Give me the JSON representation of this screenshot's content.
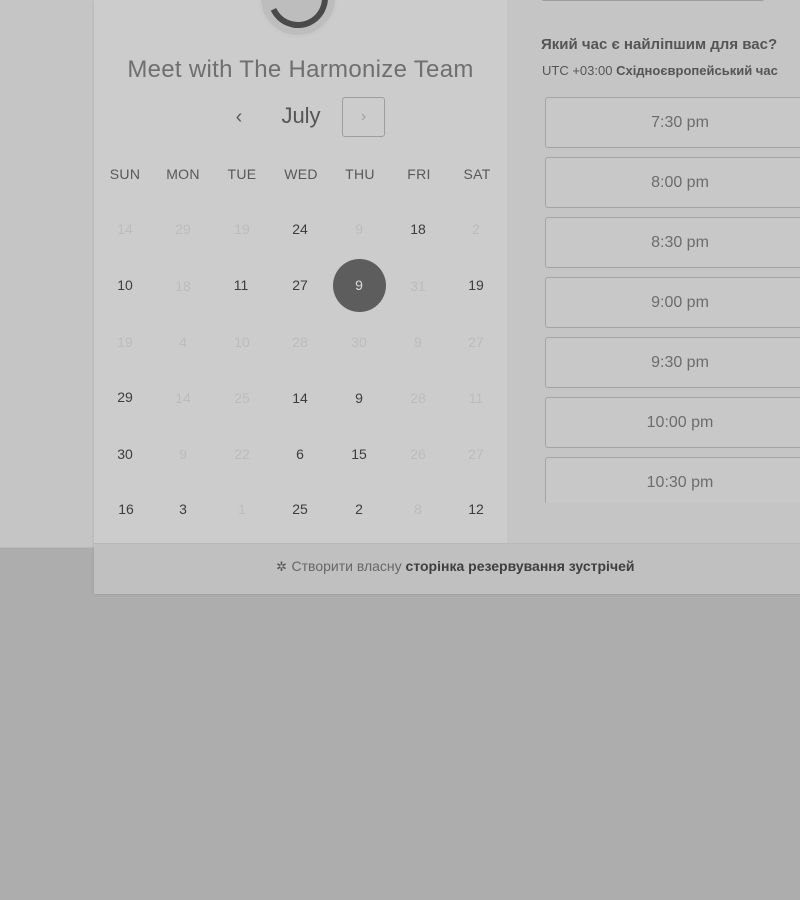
{
  "meeting": {
    "title": "Meet with The Harmonize Team",
    "avatar_dots": "•••"
  },
  "calendar": {
    "month": "July",
    "prev_icon": "‹",
    "next_icon": "›",
    "weekdays": [
      "SUN",
      "MON",
      "TUE",
      "WED",
      "THU",
      "FRI",
      "SAT"
    ],
    "weeks": [
      [
        "14",
        "29",
        "19",
        "24",
        "9",
        "18",
        "2"
      ],
      [
        "10",
        "18",
        "11",
        "27",
        "9",
        "31",
        "19"
      ],
      [
        "19",
        "4",
        "10",
        "28",
        "30",
        "9",
        "27"
      ],
      [
        "29",
        "14",
        "25",
        "14",
        "9",
        "28",
        "11"
      ],
      [
        "30",
        "9",
        "22",
        "6",
        "15",
        "26",
        "27"
      ],
      [
        "16",
        "3",
        "1",
        "25",
        "2",
        "8",
        "12"
      ]
    ],
    "selected_day": "9"
  },
  "time_picker": {
    "heading": "Який час є найліпшим для вас?",
    "timezone_offset": "UTC +03:00",
    "timezone_name": "Східноєвропейський час",
    "slots": [
      "7:30 pm",
      "8:00 pm",
      "8:30 pm",
      "9:00 pm",
      "9:30 pm",
      "10:00 pm",
      "10:30 pm"
    ]
  },
  "footer": {
    "prefix": "Створити власну",
    "link": "сторінка резервування зустрічей",
    "icon": "sprocket-icon"
  }
}
